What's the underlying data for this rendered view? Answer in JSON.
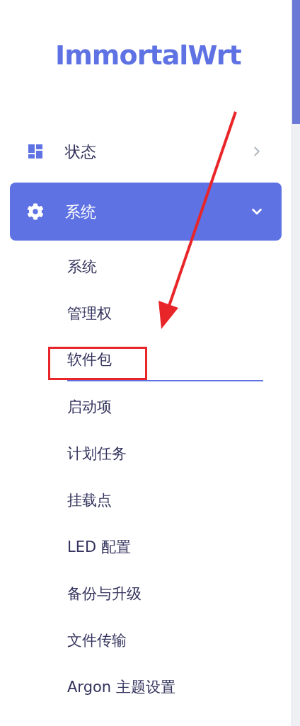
{
  "logo": "ImmortalWrt",
  "menu": [
    {
      "label": "状态",
      "kind": "dashboard",
      "expanded": false
    },
    {
      "label": "系统",
      "kind": "settings",
      "expanded": true,
      "children": [
        {
          "label": "系统",
          "selected": false,
          "annotated": false
        },
        {
          "label": "管理权",
          "selected": false,
          "annotated": false
        },
        {
          "label": "软件包",
          "selected": true,
          "annotated": true
        },
        {
          "label": "启动项",
          "selected": false,
          "annotated": false
        },
        {
          "label": "计划任务",
          "selected": false,
          "annotated": false
        },
        {
          "label": "挂载点",
          "selected": false,
          "annotated": false
        },
        {
          "label": "LED 配置",
          "selected": false,
          "annotated": false
        },
        {
          "label": "备份与升级",
          "selected": false,
          "annotated": false
        },
        {
          "label": "文件传输",
          "selected": false,
          "annotated": false
        },
        {
          "label": "Argon 主题设置",
          "selected": false,
          "annotated": false
        }
      ]
    }
  ]
}
